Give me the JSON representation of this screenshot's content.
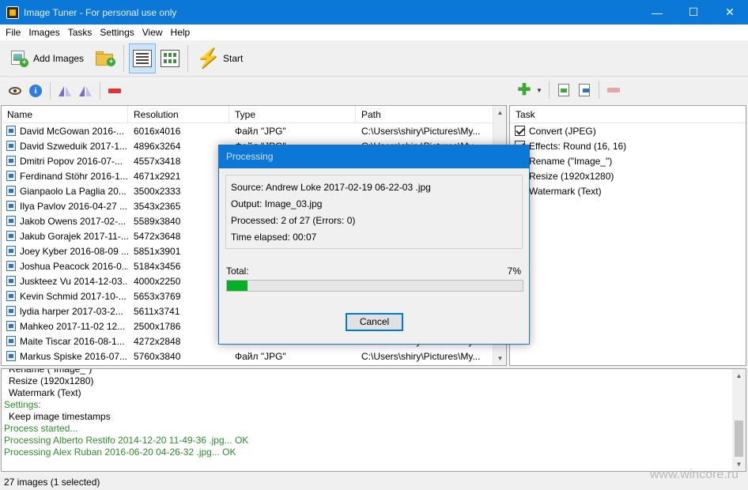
{
  "window": {
    "title": "Image Tuner - For personal use only",
    "minimize": "—",
    "maximize": "☐",
    "close": "✕"
  },
  "menu": [
    "File",
    "Images",
    "Tasks",
    "Settings",
    "View",
    "Help"
  ],
  "toolbar": {
    "add_images": "Add Images",
    "start": "Start"
  },
  "file_list": {
    "columns": [
      "Name",
      "Resolution",
      "Type",
      "Path"
    ],
    "rows": [
      {
        "name": "David McGowan  2016-...",
        "res": "6016x4016",
        "type": "Файл \"JPG\"",
        "path": "C:\\Users\\shiry\\Pictures\\My..."
      },
      {
        "name": "David Szweduik  2017-1...",
        "res": "4896x3264",
        "type": "Файл \"JPG\"",
        "path": "C:\\Users\\shiry\\Pictures\\My..."
      },
      {
        "name": "Dmitri  Popov  2016-07-...",
        "res": "4557x3418",
        "type": "",
        "path": ""
      },
      {
        "name": "Ferdinand Stöhr  2016-1...",
        "res": "4671x2921",
        "type": "",
        "path": ""
      },
      {
        "name": "Gianpaolo La Paglia  20...",
        "res": "3500x2333",
        "type": "",
        "path": ""
      },
      {
        "name": "Ilya Pavlov  2016-04-27 ...",
        "res": "3543x2365",
        "type": "",
        "path": ""
      },
      {
        "name": "Jakob Owens  2017-02-...",
        "res": "5589x3840",
        "type": "",
        "path": ""
      },
      {
        "name": "Jakub Gorajek  2017-11-...",
        "res": "5472x3648",
        "type": "",
        "path": ""
      },
      {
        "name": "Joey Kyber  2016-08-09 ...",
        "res": "5851x3901",
        "type": "",
        "path": ""
      },
      {
        "name": "Joshua Peacock  2016-0...",
        "res": "5184x3456",
        "type": "",
        "path": ""
      },
      {
        "name": "Juskteez Vu  2014-12-03...",
        "res": "4000x2250",
        "type": "",
        "path": ""
      },
      {
        "name": "Kevin Schmid  2017-10-...",
        "res": "5653x3769",
        "type": "",
        "path": ""
      },
      {
        "name": "lydia harper  2017-03-2...",
        "res": "5611x3741",
        "type": "",
        "path": ""
      },
      {
        "name": "Mahkeo  2017-11-02 12...",
        "res": "2500x1786",
        "type": "",
        "path": ""
      },
      {
        "name": "Maite Tiscar  2016-08-1...",
        "res": "4272x2848",
        "type": "Файл \"JPG\"",
        "path": "C:\\Users\\shiry\\Pictures\\My..."
      },
      {
        "name": "Markus Spiske  2016-07...",
        "res": "5760x3840",
        "type": "Файл \"JPG\"",
        "path": "C:\\Users\\shiry\\Pictures\\My..."
      }
    ]
  },
  "task_panel": {
    "header": "Task",
    "items": [
      {
        "label": "Convert (JPEG)",
        "checked": true
      },
      {
        "label": "Effects: Round (16, 16)",
        "checked": true
      },
      {
        "label": "Rename (\"Image_\")",
        "checked": true
      },
      {
        "label": "Resize (1920x1280)",
        "checked": true
      },
      {
        "label": "Watermark (Text)",
        "checked": true
      }
    ]
  },
  "log": [
    {
      "text": "Rename (\"Image_\")",
      "style": "indent"
    },
    {
      "text": "Resize (1920x1280)",
      "style": "indent"
    },
    {
      "text": "Watermark (Text)",
      "style": "indent"
    },
    {
      "text": "Settings:",
      "style": "green"
    },
    {
      "text": "Keep image timestamps",
      "style": "indent"
    },
    {
      "text": "Process started...",
      "style": "green"
    },
    {
      "text": "Processing Alberto Restifo  2014-12-20 11-49-36 .jpg... OK",
      "style": "green"
    },
    {
      "text": "Processing Alex Ruban  2016-06-20 04-26-32 .jpg... OK",
      "style": "green"
    }
  ],
  "status": "27 images (1 selected)",
  "watermark": "www.wincore.ru",
  "dialog": {
    "title": "Processing",
    "source": "Source: Andrew Loke  2017-02-19 06-22-03 .jpg",
    "output": "Output: Image_03.jpg",
    "processed": "Processed: 2 of 27 (Errors: 0)",
    "elapsed": "Time elapsed: 00:07",
    "total_label": "Total:",
    "percent": "7%",
    "progress": 0.07,
    "cancel": "Cancel"
  },
  "colors": {
    "titlebar": "#0b77d7",
    "log_green": "#2e8b2e",
    "progress_fill": "#06b025"
  }
}
